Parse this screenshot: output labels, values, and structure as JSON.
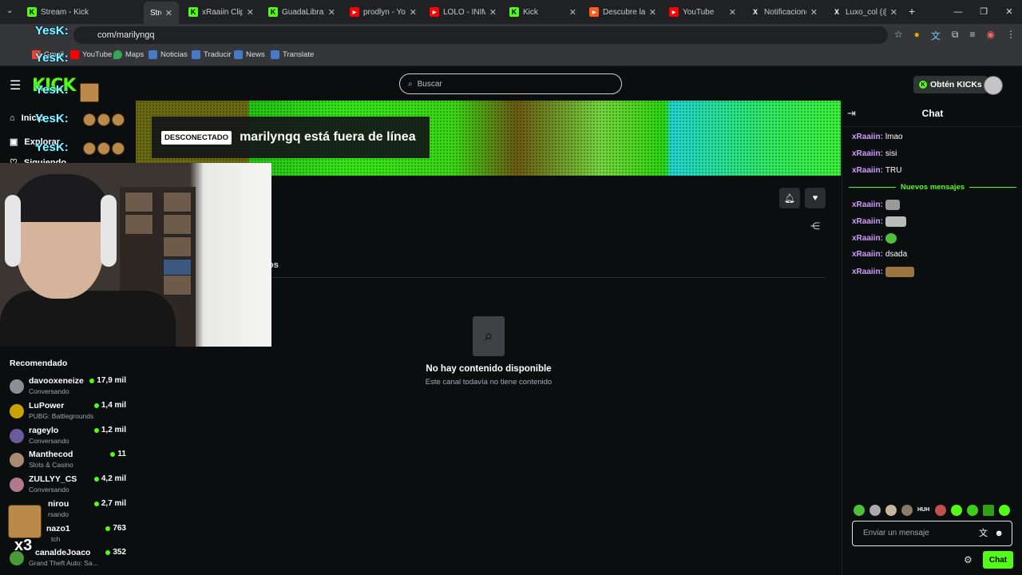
{
  "browser": {
    "tabs": [
      {
        "title": "Stream - Kick",
        "fav": "K",
        "color": "#53fc18"
      },
      {
        "title": "Strea",
        "fav": "",
        "color": "#35363a",
        "active": true
      },
      {
        "title": "xRaaiin Clips -",
        "fav": "K",
        "color": "#53fc18"
      },
      {
        "title": "GuadaLibrandi",
        "fav": "K",
        "color": "#53fc18"
      },
      {
        "title": "prodlyn - YouT",
        "fav": "▶",
        "color": "#ff0000"
      },
      {
        "title": "LOLO - INIMU",
        "fav": "▶",
        "color": "#ff0000"
      },
      {
        "title": "Kick",
        "fav": "K",
        "color": "#53fc18"
      },
      {
        "title": "Descubre las c",
        "fav": "▶",
        "color": "#ff5a1f"
      },
      {
        "title": "YouTube",
        "fav": "▶",
        "color": "#ff0000"
      },
      {
        "title": "Notificaciones",
        "fav": "X",
        "color": "#202124"
      },
      {
        "title": "Luxo_col (@lu",
        "fav": "X",
        "color": "#202124"
      }
    ],
    "new_tab": "+",
    "url": "com/marilyngq",
    "bookmarks": [
      "Gmail",
      "YouTube",
      "Maps",
      "Noticias",
      "Traducir",
      "News",
      "Translate"
    ]
  },
  "kick": {
    "search_placeholder": "Buscar",
    "kicks_button": "Obtén KICKs",
    "nav": {
      "home": "Inicio",
      "explore": "Explorar",
      "following": "Siguiendo"
    },
    "offline_badge": "DESCONECTADO",
    "offline_message": "marilyngq está fuera de línea",
    "tab_stub": "os",
    "empty_title": "No hay contenido disponible",
    "empty_subtitle": "Este canal todavía no tiene contenido"
  },
  "recommended": {
    "title": "Recomendado",
    "items": [
      {
        "name": "davooxeneize",
        "game": "Conversando",
        "viewers": "17,9 mil"
      },
      {
        "name": "LuPower",
        "game": "PUBG: Battlegrounds",
        "viewers": "1,4 mil"
      },
      {
        "name": "rageylo",
        "game": "Conversando",
        "viewers": "1,2 mil"
      },
      {
        "name": "Manthecod",
        "game": "Slots & Casino",
        "viewers": "11"
      },
      {
        "name": "ZULLYY_CS",
        "game": "Conversando",
        "viewers": "4,2 mil"
      },
      {
        "name": "nirou",
        "game": "rsando",
        "viewers": "2,7 mil"
      },
      {
        "name": "nazo1",
        "game": "tch",
        "viewers": "763"
      },
      {
        "name": "canaldeJoaco",
        "game": "Grand Theft Auto: Sa...",
        "viewers": "352"
      }
    ]
  },
  "overlay": {
    "word": "YesK:",
    "combo": "x3"
  },
  "chat": {
    "title": "Chat",
    "new_messages": "Nuevos mensajes",
    "messages": [
      {
        "user": "xRaaiin:",
        "text": "lmao"
      },
      {
        "user": "xRaaiin:",
        "text": "sisi"
      },
      {
        "user": "xRaaiin:",
        "text": "TRU"
      },
      {
        "user": "xRaaiin:",
        "text": ""
      },
      {
        "user": "xRaaiin:",
        "text": ""
      },
      {
        "user": "xRaaiin:",
        "text": ""
      },
      {
        "user": "xRaaiin:",
        "text": "dsada"
      },
      {
        "user": "xRaaiin:",
        "text": ""
      }
    ],
    "input_placeholder": "Enviar un mensaje",
    "send_button": "Chat",
    "emote_badge": "HUH"
  },
  "colors": {
    "accent": "#53fc18",
    "username": "#d09cff"
  }
}
